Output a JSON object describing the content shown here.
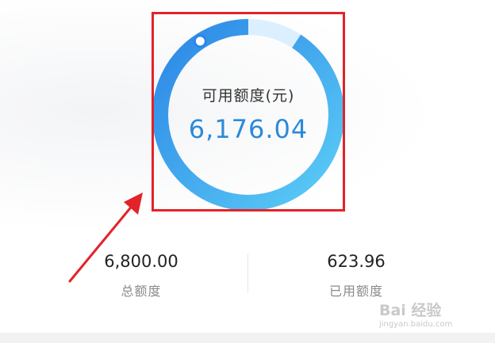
{
  "credit": {
    "available_label": "可用额度(元)",
    "available_value": "6,176.04",
    "used_fraction": 0.092
  },
  "stats": {
    "total_value": "6,800.00",
    "total_label": "总额度",
    "used_value": "623.96",
    "used_label": "已用额度"
  },
  "watermark": {
    "brand": "Bai 经验",
    "url": "jingyan.baidu.com"
  },
  "colors": {
    "ring_start": "#5ccdf6",
    "ring_end": "#2b86e6",
    "track": "#dcefff",
    "value_text": "#2b8ad8",
    "annotation": "#e2232a"
  }
}
